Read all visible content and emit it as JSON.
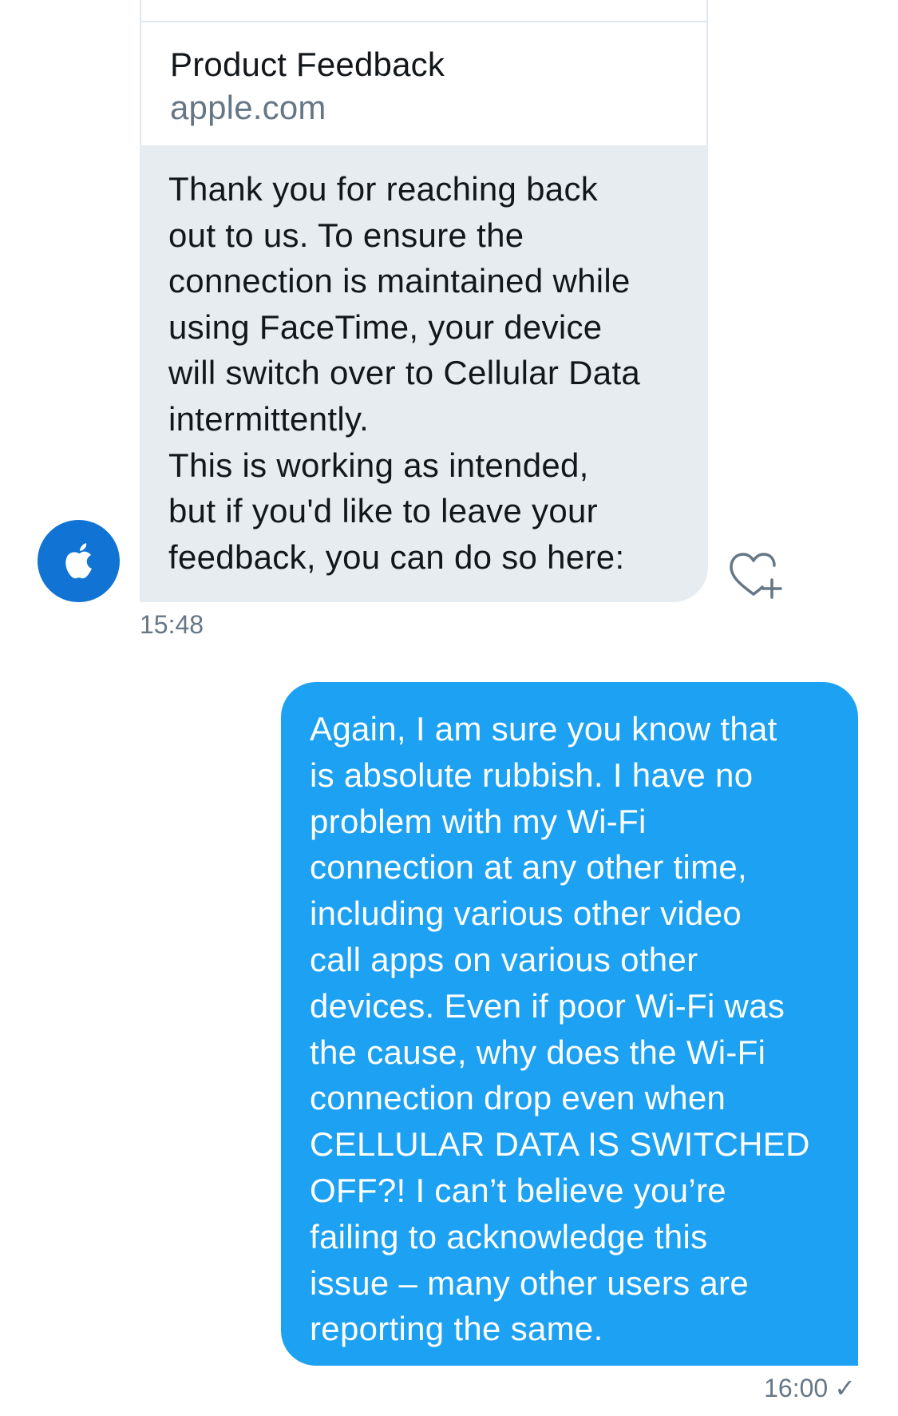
{
  "conversation": {
    "received_message": {
      "link_card": {
        "title": "Product Feedback",
        "domain": "apple.com"
      },
      "text": "Thank you for reaching back\nout to us. To ensure the\nconnection is maintained while\nusing FaceTime, your device\nwill switch over to Cellular Data\nintermittently.\nThis is working as intended,\nbut if you'd like to leave your\nfeedback, you can do so here:",
      "time": "15:48",
      "avatar_icon": "apple-logo-icon",
      "like_icon": "heart-plus-icon"
    },
    "sent_message": {
      "text": "Again, I am sure you know that\nis absolute rubbish. I have no\nproblem with my Wi-Fi\nconnection at any other time,\nincluding various other video\ncall apps on various other\ndevices. Even if poor Wi-Fi was\nthe cause, why does the Wi-Fi\nconnection drop even when\nCELLULAR DATA IS SWITCHED\nOFF?! I can’t believe you’re\nfailing to acknowledge this\nissue – many other users are\nreporting the same.",
      "time": "16:00",
      "status_icon": "read-check-icon",
      "status_glyph": "✓"
    }
  },
  "colors": {
    "received_bubble": "#e6ecf0",
    "sent_bubble": "#1da1f2",
    "avatar": "#1173d4",
    "secondary_text": "#657786"
  }
}
